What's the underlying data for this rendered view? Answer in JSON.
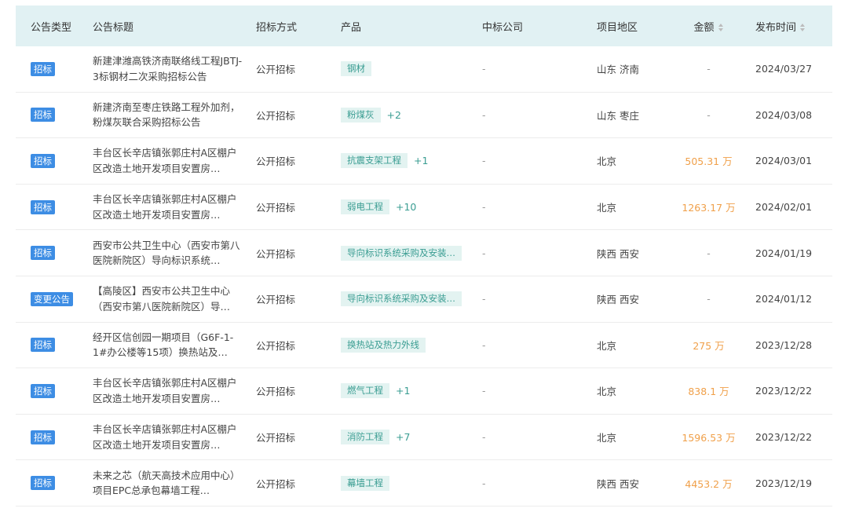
{
  "headers": {
    "type": "公告类型",
    "title": "公告标题",
    "method": "招标方式",
    "product": "产品",
    "winner": "中标公司",
    "region": "项目地区",
    "amount": "金额",
    "date": "发布时间"
  },
  "rows": [
    {
      "type": "招标",
      "title": "新建津潍高铁济南联络线工程JBTJ-3标钢材二次采购招标公告",
      "method": "公开招标",
      "tag": "钢材",
      "more": "",
      "winner": "-",
      "region": "山东 济南",
      "amount": "-",
      "date": "2024/03/27"
    },
    {
      "type": "招标",
      "title": "新建济南至枣庄铁路工程外加剂，粉煤灰联合采购招标公告",
      "method": "公开招标",
      "tag": "粉煤灰",
      "more": "+2",
      "winner": "-",
      "region": "山东 枣庄",
      "amount": "-",
      "date": "2024/03/08"
    },
    {
      "type": "招标",
      "title": "丰台区长辛店镇张郭庄村A区棚户区改造土地开发项目安置房…",
      "method": "公开招标",
      "tag": "抗震支架工程",
      "more": "+1",
      "winner": "-",
      "region": "北京",
      "amount": "505.31 万",
      "date": "2024/03/01"
    },
    {
      "type": "招标",
      "title": "丰台区长辛店镇张郭庄村A区棚户区改造土地开发项目安置房…",
      "method": "公开招标",
      "tag": "弱电工程",
      "more": "+10",
      "winner": "-",
      "region": "北京",
      "amount": "1263.17 万",
      "date": "2024/02/01"
    },
    {
      "type": "招标",
      "title": "西安市公共卫生中心（西安市第八医院新院区）导向标识系统…",
      "method": "公开招标",
      "tag": "导向标识系统采购及安装…",
      "more": "",
      "winner": "-",
      "region": "陕西 西安",
      "amount": "-",
      "date": "2024/01/19"
    },
    {
      "type": "变更公告",
      "title": "【高陵区】西安市公共卫生中心（西安市第八医院新院区）导…",
      "method": "公开招标",
      "tag": "导向标识系统采购及安装…",
      "more": "",
      "winner": "-",
      "region": "陕西 西安",
      "amount": "-",
      "date": "2024/01/12"
    },
    {
      "type": "招标",
      "title": "经开区信创园一期项目（G6F-1-1#办公楼等15项）换热站及…",
      "method": "公开招标",
      "tag": "换热站及热力外线",
      "more": "",
      "winner": "-",
      "region": "北京",
      "amount": "275 万",
      "date": "2023/12/28"
    },
    {
      "type": "招标",
      "title": "丰台区长辛店镇张郭庄村A区棚户区改造土地开发项目安置房…",
      "method": "公开招标",
      "tag": "燃气工程",
      "more": "+1",
      "winner": "-",
      "region": "北京",
      "amount": "838.1 万",
      "date": "2023/12/22"
    },
    {
      "type": "招标",
      "title": "丰台区长辛店镇张郭庄村A区棚户区改造土地开发项目安置房…",
      "method": "公开招标",
      "tag": "消防工程",
      "more": "+7",
      "winner": "-",
      "region": "北京",
      "amount": "1596.53 万",
      "date": "2023/12/22"
    },
    {
      "type": "招标",
      "title": "未来之芯（航天高技术应用中心）项目EPC总承包幕墙工程…",
      "method": "公开招标",
      "tag": "幕墙工程",
      "more": "",
      "winner": "-",
      "region": "陕西 西安",
      "amount": "4453.2 万",
      "date": "2023/12/19"
    }
  ],
  "colors": {
    "header_bg": "#e1f1f3",
    "badge": "#3d8de4",
    "tag_bg": "#e3f3f1",
    "tag_text": "#3a9d92",
    "amount": "#f0a04a"
  },
  "icons": {
    "sort": "sort-arrows-icon"
  }
}
